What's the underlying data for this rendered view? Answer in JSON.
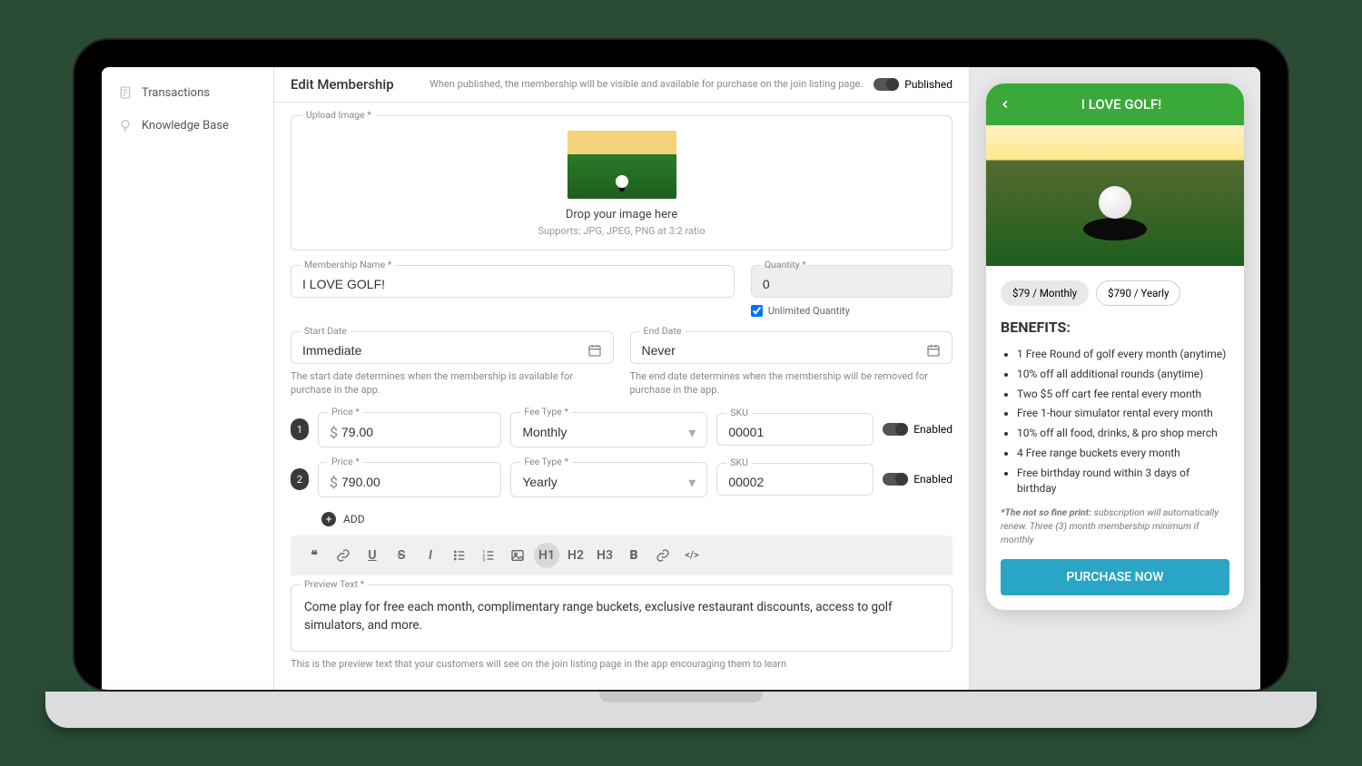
{
  "sidebar": {
    "items": [
      {
        "label": "Transactions",
        "icon": "transactions-icon"
      },
      {
        "label": "Knowledge Base",
        "icon": "lightbulb-icon"
      }
    ]
  },
  "header": {
    "title": "Edit Membership",
    "description": "When published, the membership will be visible and available for purchase on the join listing page.",
    "published_label": "Published"
  },
  "upload": {
    "legend": "Upload Image *",
    "drop_text": "Drop your image here",
    "supports": "Supports: JPG, JPEG, PNG at 3:2 ratio"
  },
  "membership_name": {
    "legend": "Membership Name *",
    "value": "I LOVE GOLF!"
  },
  "quantity": {
    "legend": "Quantity *",
    "value": "0",
    "unlimited_label": "Unlimited Quantity"
  },
  "start_date": {
    "legend": "Start Date",
    "value": "Immediate",
    "helper": "The start date determines when the membership is available for purchase in the app."
  },
  "end_date": {
    "legend": "End Date",
    "value": "Never",
    "helper": "The end date determines when the membership will be removed for purchase in the app."
  },
  "price_rows": [
    {
      "num": "1",
      "price_legend": "Price *",
      "price": "79.00",
      "fee_legend": "Fee Type *",
      "fee": "Monthly",
      "sku_legend": "SKU",
      "sku": "00001",
      "enabled": "Enabled"
    },
    {
      "num": "2",
      "price_legend": "Price *",
      "price": "790.00",
      "fee_legend": "Fee Type *",
      "fee": "Yearly",
      "sku_legend": "SKU",
      "sku": "00002",
      "enabled": "Enabled"
    }
  ],
  "add_button": "ADD",
  "toolbar_items": [
    "❝",
    "🔗",
    "U",
    "S",
    "I",
    "list",
    "numlist",
    "img",
    "H1",
    "H2",
    "H3",
    "B",
    "🔗",
    "</>"
  ],
  "preview": {
    "legend": "Preview Text *",
    "value": "Come play for free each month, complimentary range buckets, exclusive restaurant discounts, access to golf simulators, and more.",
    "helper": "This is the preview text that your customers will see on the join listing page in the app encouraging them to learn"
  },
  "phone": {
    "title": "I LOVE GOLF!",
    "pills": [
      "$79 / Monthly",
      "$790 / Yearly"
    ],
    "benefits_heading": "BENEFITS:",
    "benefits": [
      "1 Free Round of golf every month (anytime)",
      "10% off all additional rounds (anytime)",
      "Two $5 off cart fee rental every month",
      "Free 1-hour simulator rental every month",
      "10% off all food, drinks, & pro shop merch",
      "4 Free range buckets every month",
      "Free birthday round within 3 days of birthday"
    ],
    "fine_print_label": "*The not so fine print:",
    "fine_print": "subscription will automatically renew. Three (3) month membership minimum if monthly",
    "purchase": "PURCHASE NOW"
  }
}
